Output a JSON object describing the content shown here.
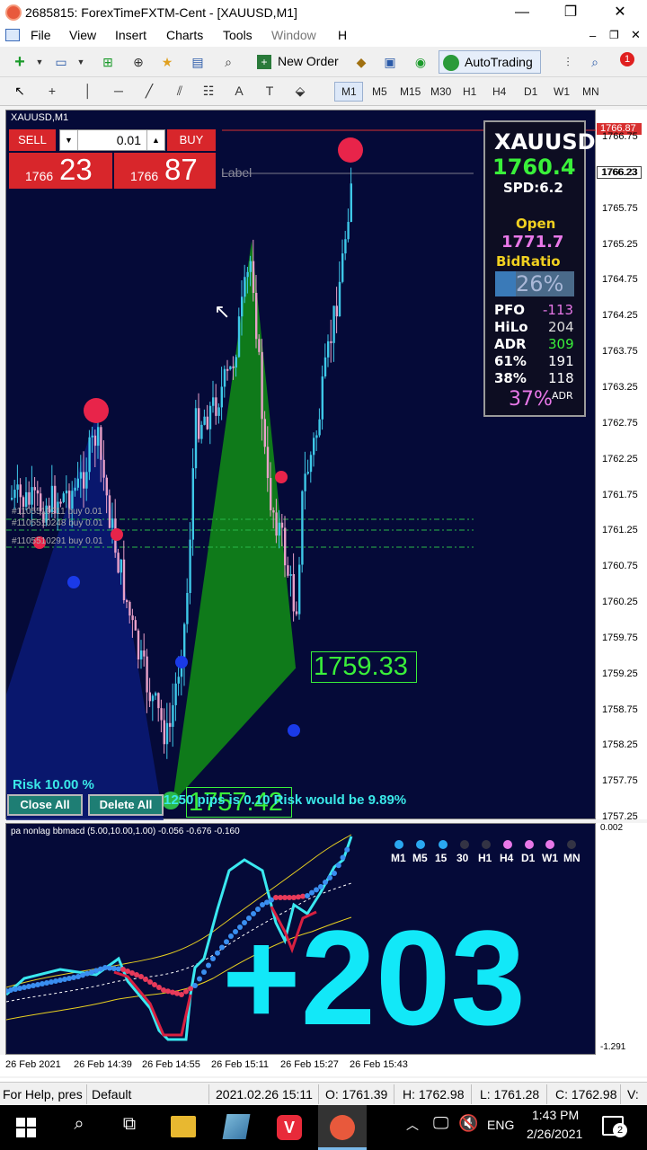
{
  "window": {
    "title": "2685815: ForexTimeFXTM-Cent - [XAUUSD,M1]",
    "controls": [
      "—",
      "❐",
      "✕"
    ]
  },
  "menu": {
    "items": [
      "File",
      "View",
      "Insert",
      "Charts",
      "Tools",
      "Window",
      "H"
    ]
  },
  "toolbar": {
    "new_order": "New Order",
    "autotrading": "AutoTrading",
    "notification_count": "1",
    "timeframes": [
      "M1",
      "M5",
      "M15",
      "M30",
      "H1",
      "H4",
      "D1",
      "W1",
      "MN"
    ],
    "active_timeframe": "M1"
  },
  "chart": {
    "symbol_label": "XAUUSD,M1",
    "price_labels": [
      "1766.75",
      "1766.23",
      "1765.75",
      "1765.25",
      "1764.75",
      "1764.25",
      "1763.75",
      "1763.25",
      "1762.75",
      "1762.25",
      "1761.75",
      "1761.25",
      "1760.75",
      "1760.25",
      "1759.75",
      "1759.25",
      "1758.75",
      "1758.25",
      "1757.75",
      "1757.25"
    ],
    "top_red_label": "1766.87",
    "current_price_label": "1766.23",
    "time_labels": [
      "26 Feb 2021",
      "26 Feb 14:39",
      "26 Feb 14:55",
      "26 Feb 15:11",
      "26 Feb 15:27",
      "26 Feb 15:43"
    ],
    "text_label": "Label",
    "pattern_price_1": "1759.33",
    "pattern_price_2": "1757.42",
    "order_lines": [
      "#1105510211 buy 0.01",
      "#1105510248 buy 0.01",
      "#1105510291 buy 0.01"
    ],
    "risk_text": "Risk 10.00 %",
    "risk_note": "1250 pips is 0.10 Risk would be 9.89%",
    "colors": {
      "background": "#050a38",
      "bull": "#3ec8e8",
      "bear": "#e8a0c8",
      "pattern": "#0f7a1a",
      "marker": "#e8244a"
    }
  },
  "trade_panel": {
    "sell_label": "SELL",
    "buy_label": "BUY",
    "lot": "0.01",
    "sell_price_prefix": "1766",
    "sell_price_main": "23",
    "buy_price_prefix": "1766",
    "buy_price_main": "87"
  },
  "info_panel": {
    "symbol": "XAUUSD",
    "price": "1760.4",
    "spread": "SPD:6.2",
    "open_label": "Open",
    "open_value": "1771.7",
    "bid_ratio_label": "BidRatio",
    "bid_ratio_value": "26%",
    "rows": [
      {
        "label": "PFO",
        "value": "-113"
      },
      {
        "label": "HiLo",
        "value": "204"
      },
      {
        "label": "ADR",
        "value": "309"
      },
      {
        "label": "61%",
        "value": "191"
      },
      {
        "label": "38%",
        "value": "118"
      }
    ],
    "adr_pct": "37%",
    "adr_suffix": "ADR"
  },
  "buttons": {
    "close_all": "Close All",
    "delete_all": "Delete All"
  },
  "indicator": {
    "title": "pa nonlag bbmacd (5.00,10.00,1.00) -0.056 -0.676 -0.160",
    "scale_top": "0.002",
    "scale_bottom": "-1.291",
    "big_value": "+203",
    "timeframes": [
      "M1",
      "M5",
      "15",
      "30",
      "H1",
      "H4",
      "D1",
      "W1",
      "MN"
    ],
    "dot_colors": [
      "#2aa8f0",
      "#2aa8f0",
      "#2aa8f0",
      "#333344",
      "#333344",
      "#e878e8",
      "#e878e8",
      "#e878e8",
      "#333344"
    ]
  },
  "statusbar": {
    "help": "For Help, pres",
    "profile": "Default",
    "datetime": "2021.02.26 15:11",
    "open": "O: 1761.39",
    "high": "H: 1762.98",
    "low": "L: 1761.28",
    "close": "C: 1762.98",
    "volume": "V:"
  },
  "taskbar": {
    "language": "ENG",
    "time": "1:43 PM",
    "date": "2/26/2021",
    "notification_count": "2"
  }
}
